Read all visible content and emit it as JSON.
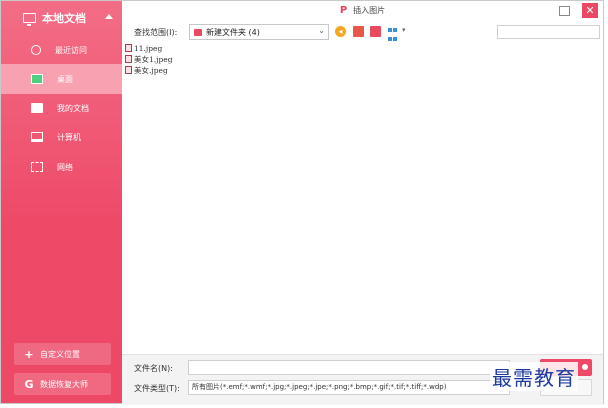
{
  "sidebar": {
    "header": "本地文档",
    "items": [
      {
        "label": "最近访问",
        "icon": "clock-icon",
        "active": false
      },
      {
        "label": "桌面",
        "icon": "desktop-icon",
        "active": true
      },
      {
        "label": "我的文档",
        "icon": "folder-icon",
        "active": false
      },
      {
        "label": "计算机",
        "icon": "computer-icon",
        "active": false
      },
      {
        "label": "网络",
        "icon": "network-icon",
        "active": false
      }
    ],
    "custom_location": "自定义位置",
    "data_recovery": "数据恢复大师"
  },
  "titlebar": {
    "title": "插入图片",
    "logo": "P"
  },
  "toolbar": {
    "lookin_label": "查找范围(I):",
    "lookin_value": "新建文件夹 (4)"
  },
  "files": [
    {
      "name": "11.jpeg"
    },
    {
      "name": "美女1.jpeg"
    },
    {
      "name": "美女.jpeg"
    }
  ],
  "bottom": {
    "filename_label": "文件名(N):",
    "filename_value": "",
    "filetype_label": "文件类型(T):",
    "filetype_value": "所有图片(*.emf;*.wmf;*.jpg;*.jpeg;*.jpe;*.png;*.bmp;*.gif;*.tif;*.tiff;*.wdp)"
  },
  "watermark": "最需教育",
  "colors": {
    "accent": "#ee4a68",
    "sidebar_active": "#f7a1b1"
  }
}
